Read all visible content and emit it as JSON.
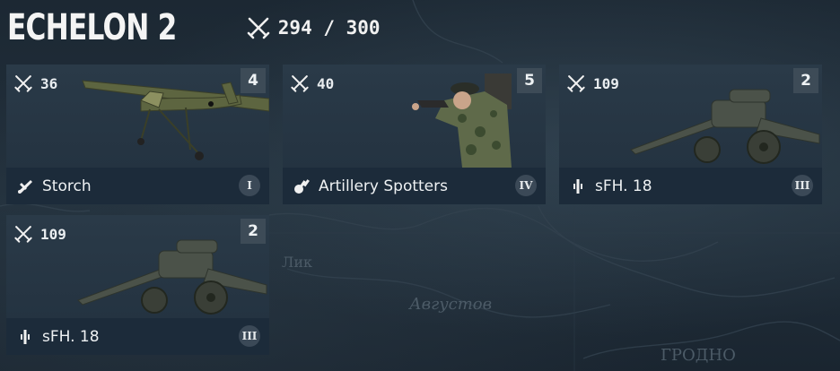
{
  "echelon": {
    "title": "ECHELON 2",
    "capacity": "294 / 300",
    "icon": "crossed-swords-icon"
  },
  "cards": [
    {
      "cost": "36",
      "count": "4",
      "name": "Storch",
      "rank": "I",
      "class_icon": "recon-plane-icon",
      "art": "plane"
    },
    {
      "cost": "40",
      "count": "5",
      "name": "Artillery Spotters",
      "rank": "IV",
      "class_icon": "spotter-icon",
      "art": "soldier"
    },
    {
      "cost": "109",
      "count": "2",
      "name": "sFH. 18",
      "rank": "III",
      "class_icon": "howitzer-icon",
      "art": "howitzer"
    },
    {
      "cost": "109",
      "count": "2",
      "name": "sFH. 18",
      "rank": "III",
      "class_icon": "howitzer-icon",
      "art": "howitzer"
    }
  ],
  "colors": {
    "background": "#1a2530",
    "card": "#1c2b3a",
    "badge": "#3d4b57",
    "text": "#eef1f3"
  },
  "map_labels": [
    "Лик",
    "Августов",
    "ГРОДНО"
  ]
}
